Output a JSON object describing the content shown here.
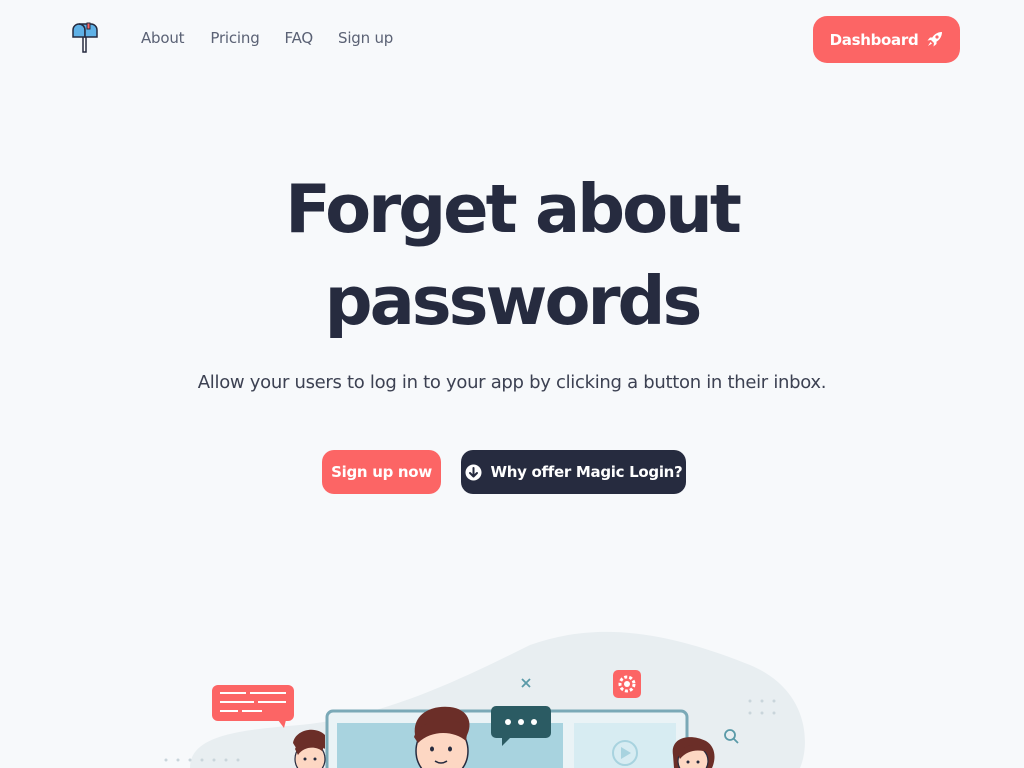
{
  "nav": {
    "links": [
      "About",
      "Pricing",
      "FAQ",
      "Sign up"
    ],
    "dashboard_label": "Dashboard"
  },
  "hero": {
    "title_line1": "Forget about",
    "title_line2": "passwords",
    "subtitle": "Allow your users to log in to your app by clicking a button in their inbox.",
    "primary_cta": "Sign up now",
    "secondary_cta": "Why offer Magic Login?"
  },
  "colors": {
    "accent": "#fc6565",
    "dark": "#262b3f",
    "background": "#f7f9fb"
  },
  "icons": {
    "logo": "mailbox-icon",
    "dashboard": "rocket-icon",
    "secondary_cta": "arrow-down-circle-icon"
  }
}
